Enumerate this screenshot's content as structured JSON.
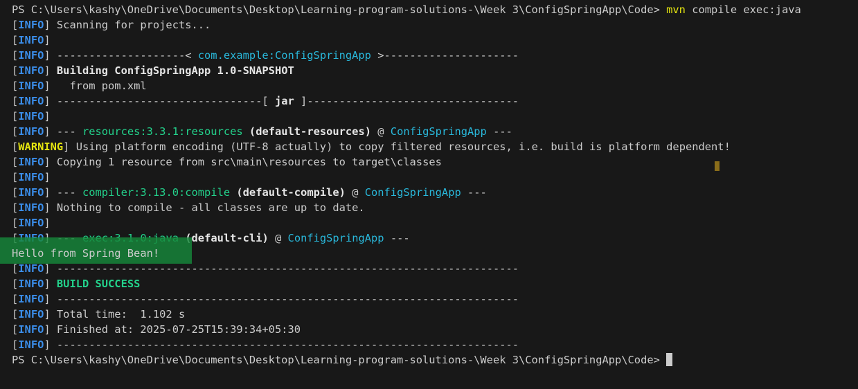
{
  "prompt": "PS C:\\Users\\kashy\\OneDrive\\Documents\\Desktop\\Learning-program-solutions-\\Week 3\\ConfigSpringApp\\Code> ",
  "command": {
    "program": "mvn",
    "args": " compile exec:java"
  },
  "info_tag": "INFO",
  "warning_tag": "WARNING",
  "lines": {
    "l1": " Scanning for projects...",
    "l3_pre": " --------------------< ",
    "l3_artifact": "com.example:ConfigSpringApp",
    "l3_post": " >---------------------",
    "l4": "Building ConfigSpringApp 1.0-SNAPSHOT",
    "l5": "   from pom.xml",
    "l6_pre": " --------------------------------[ ",
    "l6_jar": "jar",
    "l6_post": " ]---------------------------------",
    "l8_pre": " --- ",
    "l8_plugin": "resources:3.3.1:resources",
    "l8_exec": "(default-resources)",
    "l8_at": " @ ",
    "l8_proj": "ConfigSpringApp",
    "l8_post": " ---",
    "l9": " Using platform encoding (UTF-8 actually) to copy filtered resources, i.e. build is platform dependent!",
    "l10": " Copying 1 resource from src\\main\\resources to target\\classes",
    "l12_plugin": "compiler:3.13.0:compile",
    "l12_exec": "(default-compile)",
    "l13": " Nothing to compile - all classes are up to date.",
    "l15_plugin": "exec:3.1.0:java",
    "l15_exec": "(default-cli)",
    "output": "Hello from Spring Bean!",
    "separator": " ------------------------------------------------------------------------",
    "build_success": "BUILD SUCCESS",
    "total_time": " Total time:  1.102 s",
    "finished_at": " Finished at: 2025-07-25T15:39:34+05:30"
  }
}
